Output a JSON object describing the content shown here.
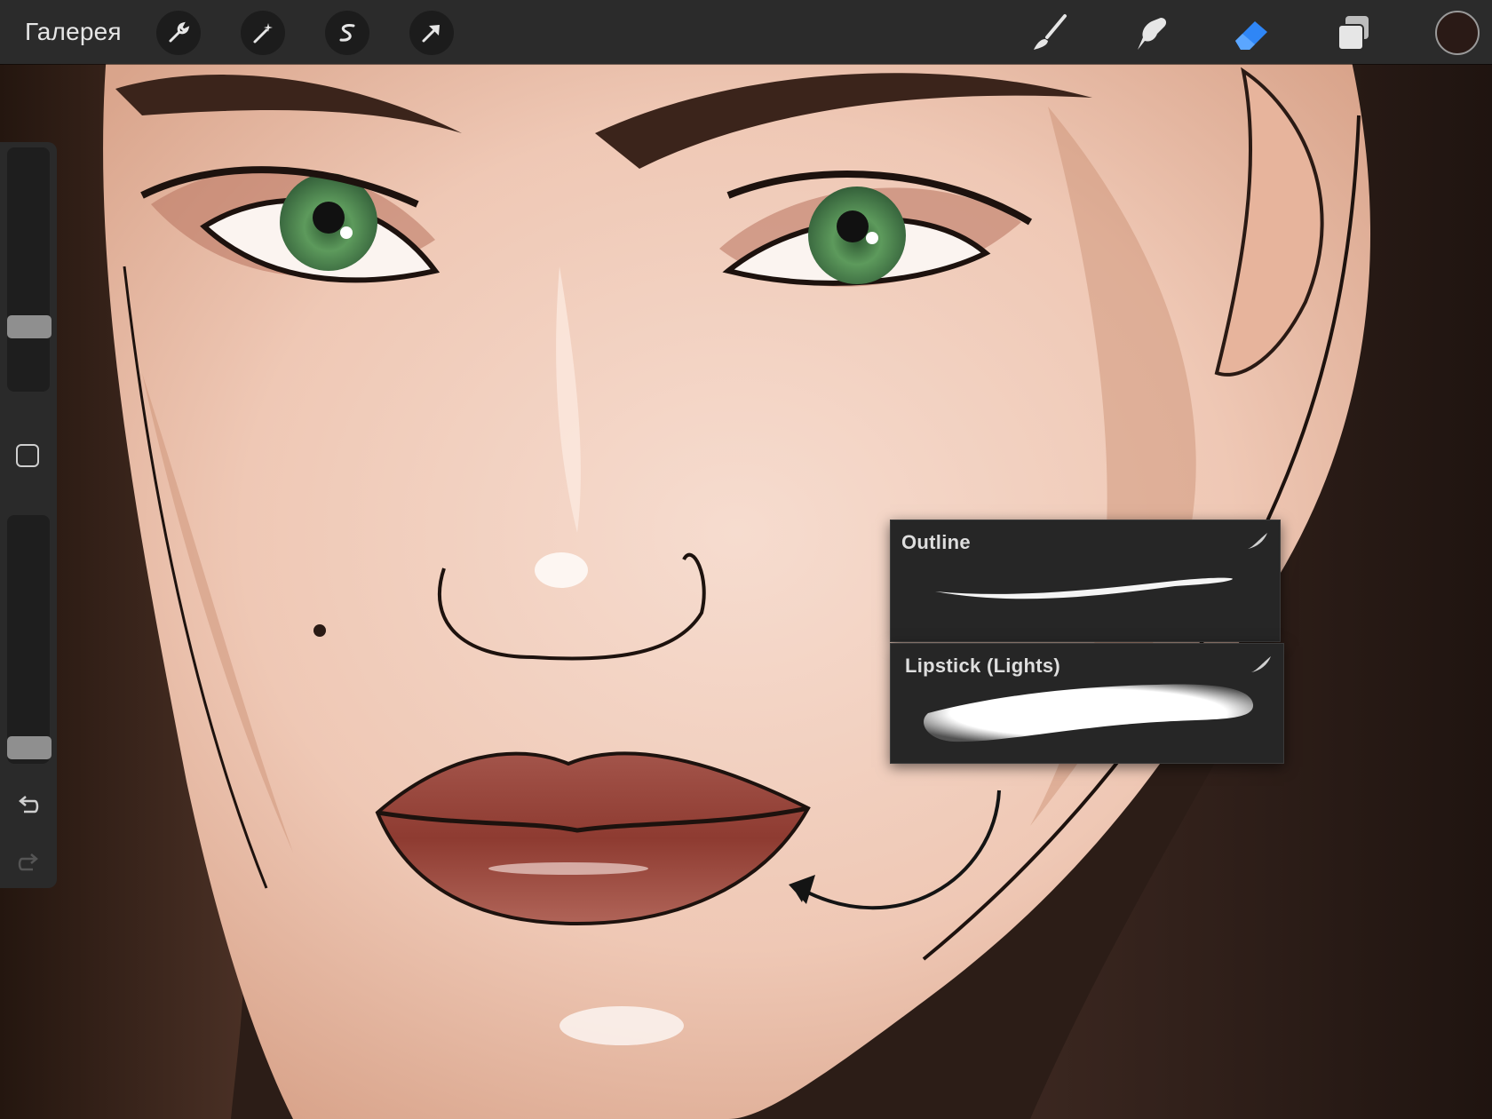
{
  "toolbar": {
    "gallery_label": "Галерея",
    "left_tools": [
      {
        "name": "actions",
        "icon": "wrench-icon"
      },
      {
        "name": "adjustments",
        "icon": "magic-wand-icon"
      },
      {
        "name": "selection",
        "icon": "selection-s-icon"
      },
      {
        "name": "transform",
        "icon": "arrow-cursor-icon"
      }
    ],
    "right_tools": [
      {
        "name": "brush",
        "icon": "brush-icon",
        "active": false
      },
      {
        "name": "smudge",
        "icon": "smudge-finger-icon",
        "active": false
      },
      {
        "name": "eraser",
        "icon": "eraser-icon",
        "active": true
      },
      {
        "name": "layers",
        "icon": "layers-icon",
        "active": false
      }
    ],
    "current_color": "#2a1a16",
    "active_color": "#2f86f6"
  },
  "sidebar": {
    "size_slider_level": 0.76,
    "opacity_slider_level": 0.98,
    "modify_icon": "square-modify-icon",
    "undo_icon": "undo-arrow-icon",
    "redo_icon": "redo-arrow-icon"
  },
  "brush_cards": [
    {
      "name": "Outline",
      "fav_icon": "brush-stroke-icon"
    },
    {
      "name": "Lipstick (Lights)",
      "fav_icon": "brush-stroke-icon"
    }
  ],
  "colors": {
    "skin": "#f0c9b7",
    "hair": "#2f1e18",
    "lips": "#9c4a3e",
    "iris": "#4f8a52",
    "ui_bar": "#2b2b2b"
  }
}
